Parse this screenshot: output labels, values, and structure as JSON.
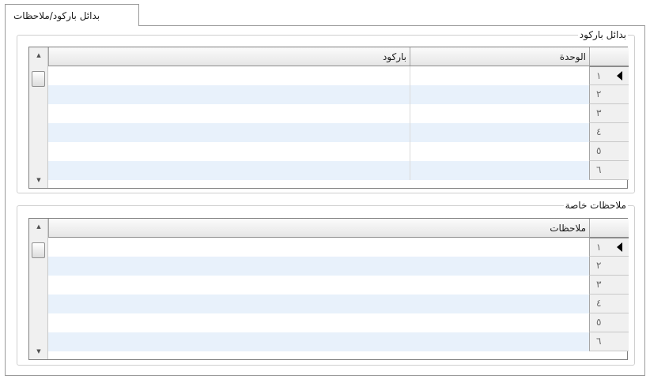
{
  "tab": {
    "label": "بدائل باركود/ملاحظات"
  },
  "barcode_group": {
    "title": "بدائل باركود",
    "columns": {
      "unit": "الوحدة",
      "barcode": "باركود"
    },
    "row_numbers": [
      "١",
      "٢",
      "٣",
      "٤",
      "٥",
      "٦"
    ]
  },
  "notes_group": {
    "title": "ملاحظات خاصة",
    "columns": {
      "notes": "ملاحظات"
    },
    "row_numbers": [
      "١",
      "٢",
      "٣",
      "٤",
      "٥",
      "٦"
    ]
  },
  "colors": {
    "alt_row": "#e8f1fb",
    "border": "#9a9a9a"
  },
  "icons": {
    "scroll_up": "triangle-up",
    "scroll_down": "triangle-down",
    "current_row": "triangle-left"
  }
}
